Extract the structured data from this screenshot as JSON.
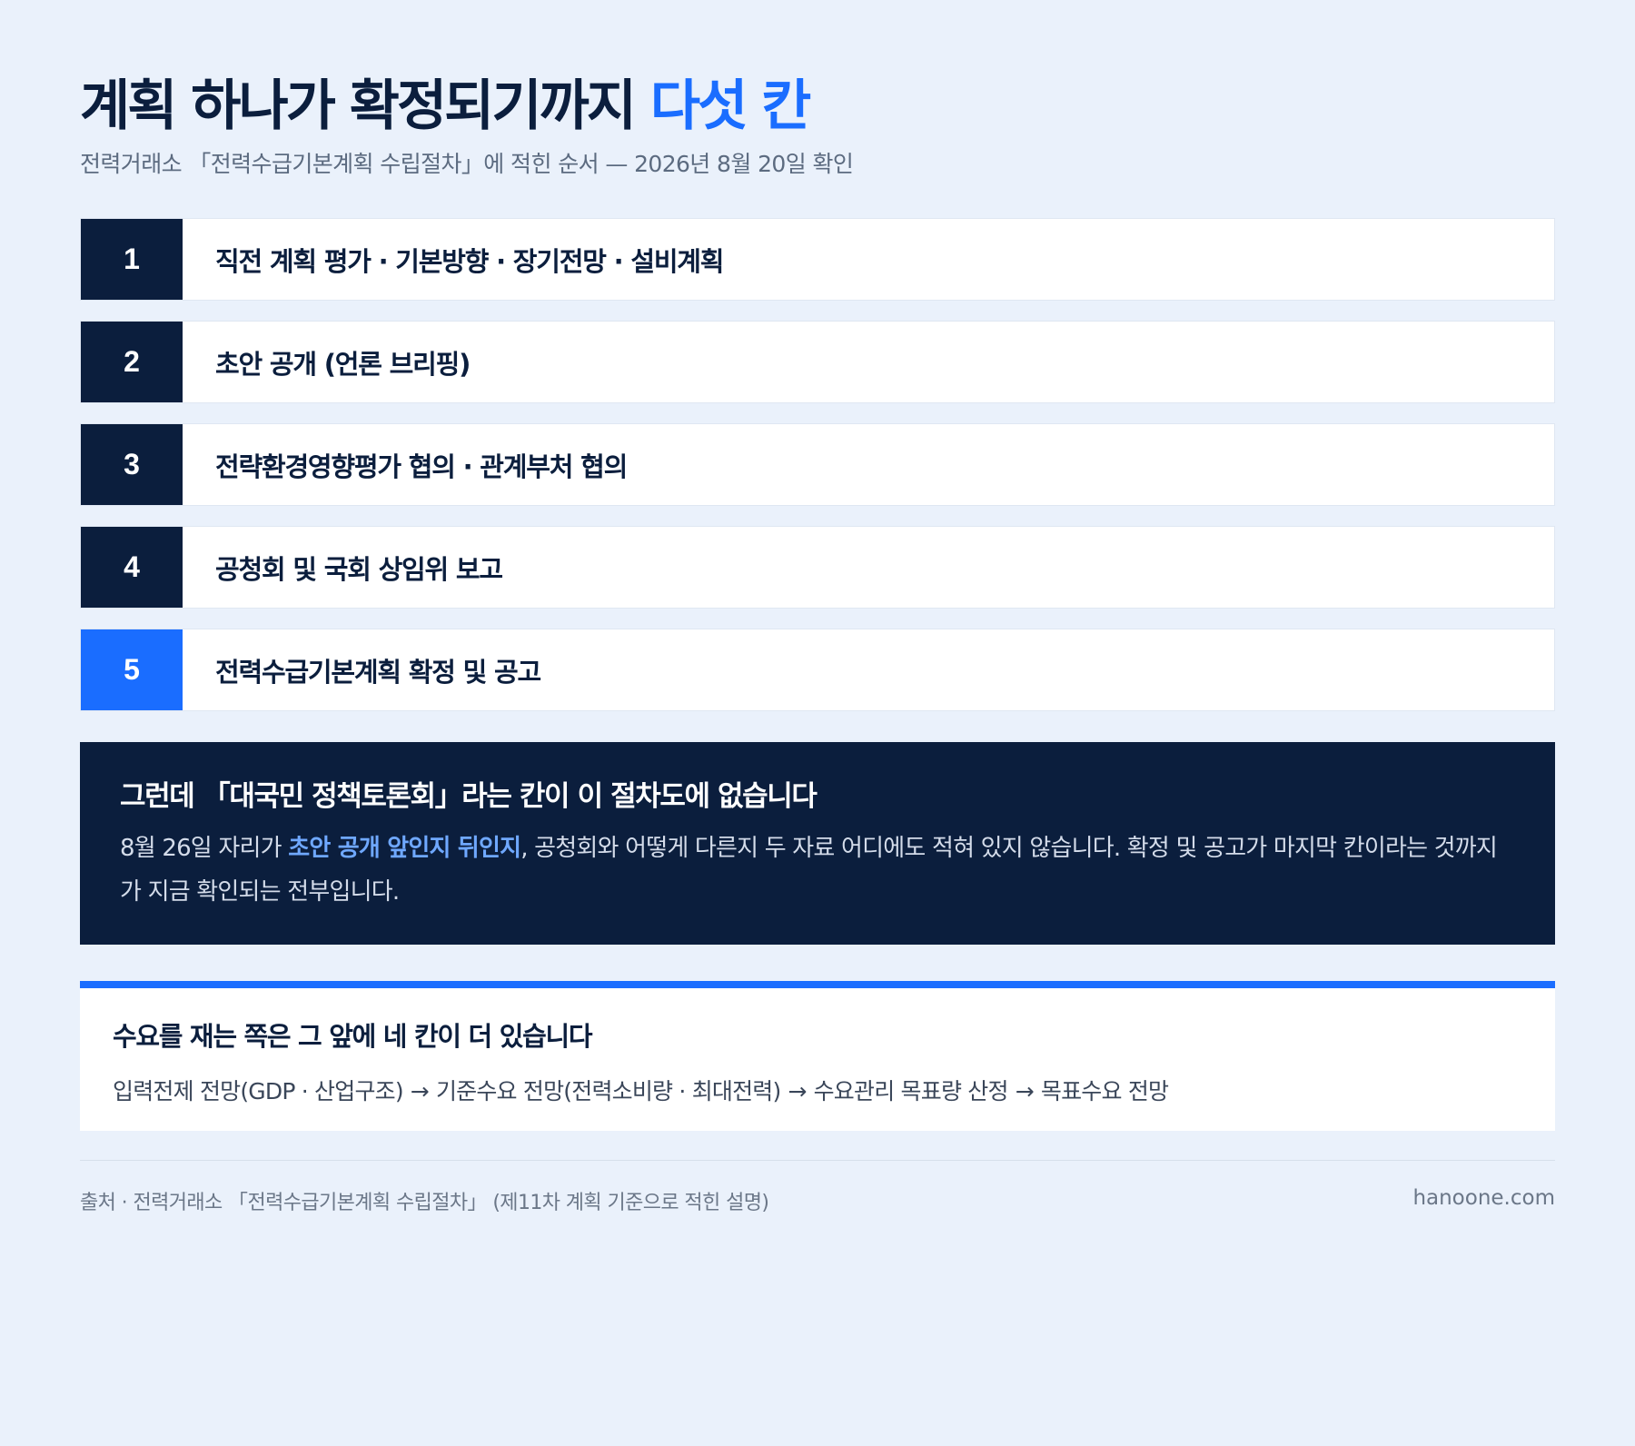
{
  "header": {
    "title_main": "계획 하나가 확정되기까지 ",
    "title_accent": "다섯 칸",
    "subtitle": "전력거래소 「전력수급기본계획 수립절차」에 적힌 순서 — 2026년 8월 20일 확인"
  },
  "steps": [
    {
      "number": "1",
      "label": "직전 계획 평가 · 기본방향 · 장기전망 · 설비계획"
    },
    {
      "number": "2",
      "label": "초안 공개 (언론 브리핑)"
    },
    {
      "number": "3",
      "label": "전략환경영향평가 협의 · 관계부처 협의"
    },
    {
      "number": "4",
      "label": "공청회 및 국회 상임위 보고"
    },
    {
      "number": "5",
      "label": "전력수급기본계획 확정 및 공고"
    }
  ],
  "notice": {
    "heading": "그런데 「대국민 정책토론회」라는 칸이 이 절차도에 없습니다",
    "body_before": "8월 26일 자리가 ",
    "body_highlight": "초안 공개 앞인지 뒤인지",
    "body_after": ", 공청회와 어떻게 다른지 두 자료 어디에도 적혀 있지 않습니다. 확정 및 공고가 마지막 칸이라는 것까지가 지금 확인되는 전부입니다."
  },
  "demand": {
    "heading": "수요를 재는 쪽은 그 앞에 네 칸이 더 있습니다",
    "flow": [
      "입력전제 전망(GDP · 산업구조)",
      "기준수요 전망(전력소비량 · 최대전력)",
      "수요관리 목표량 산정",
      "목표수요 전망"
    ],
    "arrow": "→"
  },
  "footer": {
    "source": "출처 · 전력거래소 「전력수급기본계획 수립절차」 (제11차 계획 기준으로 적힌 설명)",
    "site": "hanoone.com"
  },
  "colors": {
    "navy": "#0b1e3d",
    "accent_blue": "#1a6dff",
    "highlight_blue": "#6fa8ff",
    "background": "#eaf1fb"
  }
}
